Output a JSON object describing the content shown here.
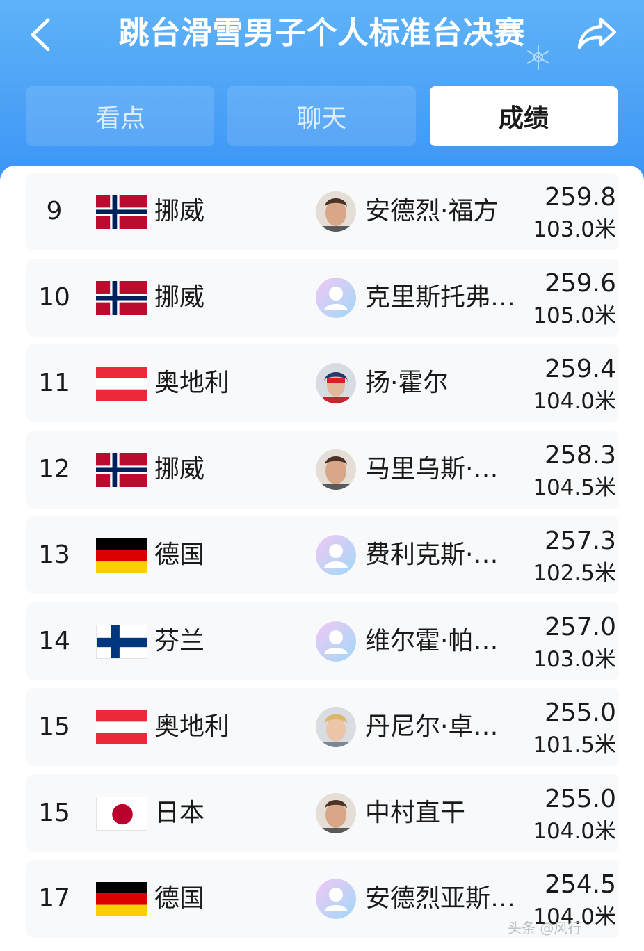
{
  "header": {
    "title": "跳台滑雪男子个人标准台决赛",
    "back_icon": "chevron-left-icon",
    "share_icon": "share-arrow-icon",
    "background_color": "#4aa3f7"
  },
  "tabs": [
    {
      "label": "看点",
      "active": false
    },
    {
      "label": "聊天",
      "active": false
    },
    {
      "label": "成绩",
      "active": true
    }
  ],
  "results": [
    {
      "rank": "9",
      "flag": "norway",
      "country": "挪威",
      "avatar": "photo-face",
      "athlete": "安德烈·福方",
      "score": "259.8",
      "distance": "103.0米"
    },
    {
      "rank": "10",
      "flag": "norway",
      "country": "挪威",
      "avatar": "placeholder",
      "athlete": "克里斯托弗…",
      "score": "259.6",
      "distance": "105.0米"
    },
    {
      "rank": "11",
      "flag": "austria",
      "country": "奥地利",
      "avatar": "photo-helmet",
      "athlete": "扬·霍尔",
      "score": "259.4",
      "distance": "104.0米"
    },
    {
      "rank": "12",
      "flag": "norway",
      "country": "挪威",
      "avatar": "photo-face",
      "athlete": "马里乌斯·…",
      "score": "258.3",
      "distance": "104.5米"
    },
    {
      "rank": "13",
      "flag": "germany",
      "country": "德国",
      "avatar": "placeholder",
      "athlete": "费利克斯·…",
      "score": "257.3",
      "distance": "102.5米"
    },
    {
      "rank": "14",
      "flag": "finland",
      "country": "芬兰",
      "avatar": "placeholder",
      "athlete": "维尔霍·帕…",
      "score": "257.0",
      "distance": "103.0米"
    },
    {
      "rank": "15",
      "flag": "austria",
      "country": "奥地利",
      "avatar": "photo-blond",
      "athlete": "丹尼尔·卓…",
      "score": "255.0",
      "distance": "101.5米"
    },
    {
      "rank": "15",
      "flag": "japan",
      "country": "日本",
      "avatar": "photo-face",
      "athlete": "中村直干",
      "score": "255.0",
      "distance": "104.0米"
    },
    {
      "rank": "17",
      "flag": "germany",
      "country": "德国",
      "avatar": "placeholder",
      "athlete": "安德烈亚斯…",
      "score": "254.5",
      "distance": "104.0米"
    }
  ],
  "watermark": "头条 @风行"
}
